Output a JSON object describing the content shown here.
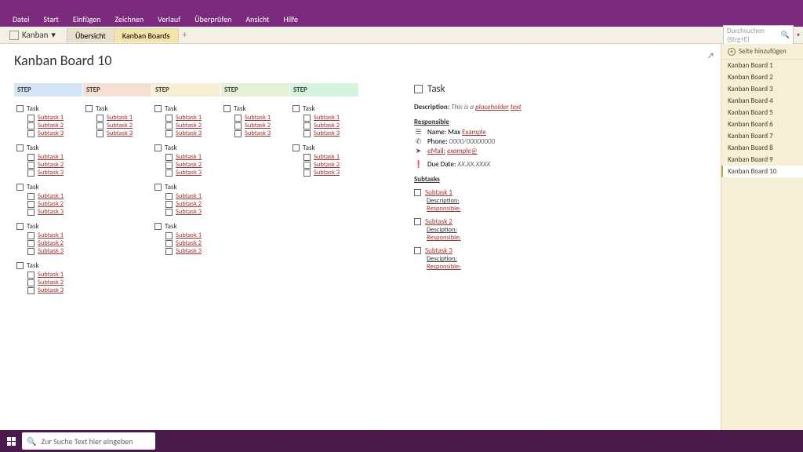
{
  "menu": [
    "Datei",
    "Start",
    "Einfügen",
    "Zeichnen",
    "Verlauf",
    "Überprüfen",
    "Ansicht",
    "Hilfe"
  ],
  "notebook": "Kanban",
  "sections": [
    {
      "label": "Übersicht",
      "active": false
    },
    {
      "label": "Kanban Boards",
      "active": true
    }
  ],
  "search_placeholder": "Durchsuchen (Strg+E)",
  "page_title": "Kanban Board 10",
  "step_label": "STEP",
  "columns": [
    {
      "tasks": [
        {
          "label": "Task",
          "subtasks": [
            "Subtask 1",
            "Subtask 2",
            "Subtask 3"
          ]
        },
        {
          "label": "Task",
          "subtasks": [
            "Subtask 1",
            "Subtask 2",
            "Subtask 3"
          ]
        },
        {
          "label": "Task",
          "subtasks": [
            "Subtask 1",
            "Subtask 2",
            "Subtask 3"
          ]
        },
        {
          "label": "Task",
          "subtasks": [
            "Subtask 1",
            "Subtask 2",
            "Subtask 3"
          ]
        },
        {
          "label": "Task",
          "subtasks": [
            "Subtask 1",
            "Subtask 2",
            "Subtask 3"
          ]
        }
      ]
    },
    {
      "tasks": [
        {
          "label": "Task",
          "subtasks": [
            "Subtask 1",
            "Subtask 2",
            "Subtask 3"
          ]
        }
      ]
    },
    {
      "tasks": [
        {
          "label": "Task",
          "subtasks": [
            "Subtask 1",
            "Subtask 2",
            "Subtask 3"
          ]
        },
        {
          "label": "Task",
          "subtasks": [
            "Subtask 1",
            "Subtask 2",
            "Subtask 3"
          ]
        },
        {
          "label": "Task",
          "subtasks": [
            "Subtask 1",
            "Subtask 2",
            "Subtask 3"
          ]
        },
        {
          "label": "Task",
          "subtasks": [
            "Subtask 1",
            "Subtask 2",
            "Subtask 3"
          ]
        }
      ]
    },
    {
      "tasks": [
        {
          "label": "Task",
          "subtasks": [
            "Subtask 1",
            "Subtask 2",
            "Subtask 3"
          ]
        }
      ]
    },
    {
      "tasks": [
        {
          "label": "Task",
          "subtasks": [
            "Subtask 1",
            "Subtask 2",
            "Subtask 3"
          ]
        },
        {
          "label": "Task",
          "subtasks": [
            "Subtask 1",
            "Subtask 2",
            "Subtask 3"
          ]
        }
      ]
    }
  ],
  "detail": {
    "title": "Task",
    "desc_label": "Description:",
    "desc_text": "This is a",
    "desc_ph": "placeholder",
    "desc_end": "text",
    "resp_label": "Responsible",
    "name_label": "Name: Max",
    "name_val": "Example",
    "phone_label": "Phone:",
    "phone_val": "0000/00000000",
    "email_label": "eMail:",
    "email_val": "example@",
    "due_label": "Due Date:",
    "due_val": "XX.XX.XXXX",
    "subtasks_label": "Subtasks",
    "subtasks": [
      {
        "name": "Subtask 1",
        "d": "Description:",
        "r": "Responsible:"
      },
      {
        "name": "Subtask 2",
        "d": "Desciption:",
        "r": "Responsible:"
      },
      {
        "name": "Subtask 3",
        "d": "Desciption:",
        "r": "Responsible:"
      }
    ]
  },
  "add_page": "Seite hinzufügen",
  "pages": [
    "Kanban Board 1",
    "Kanban Board 2",
    "Kanban Board 3",
    "Kanban Board 4",
    "Kanban Board 5",
    "Kanban Board 6",
    "Kanban Board 7",
    "Kanban Board 8",
    "Kanban Board 9",
    "Kanban Board 10"
  ],
  "selected_page_index": 9,
  "taskbar_search": "Zur Suche Text hier eingeben"
}
